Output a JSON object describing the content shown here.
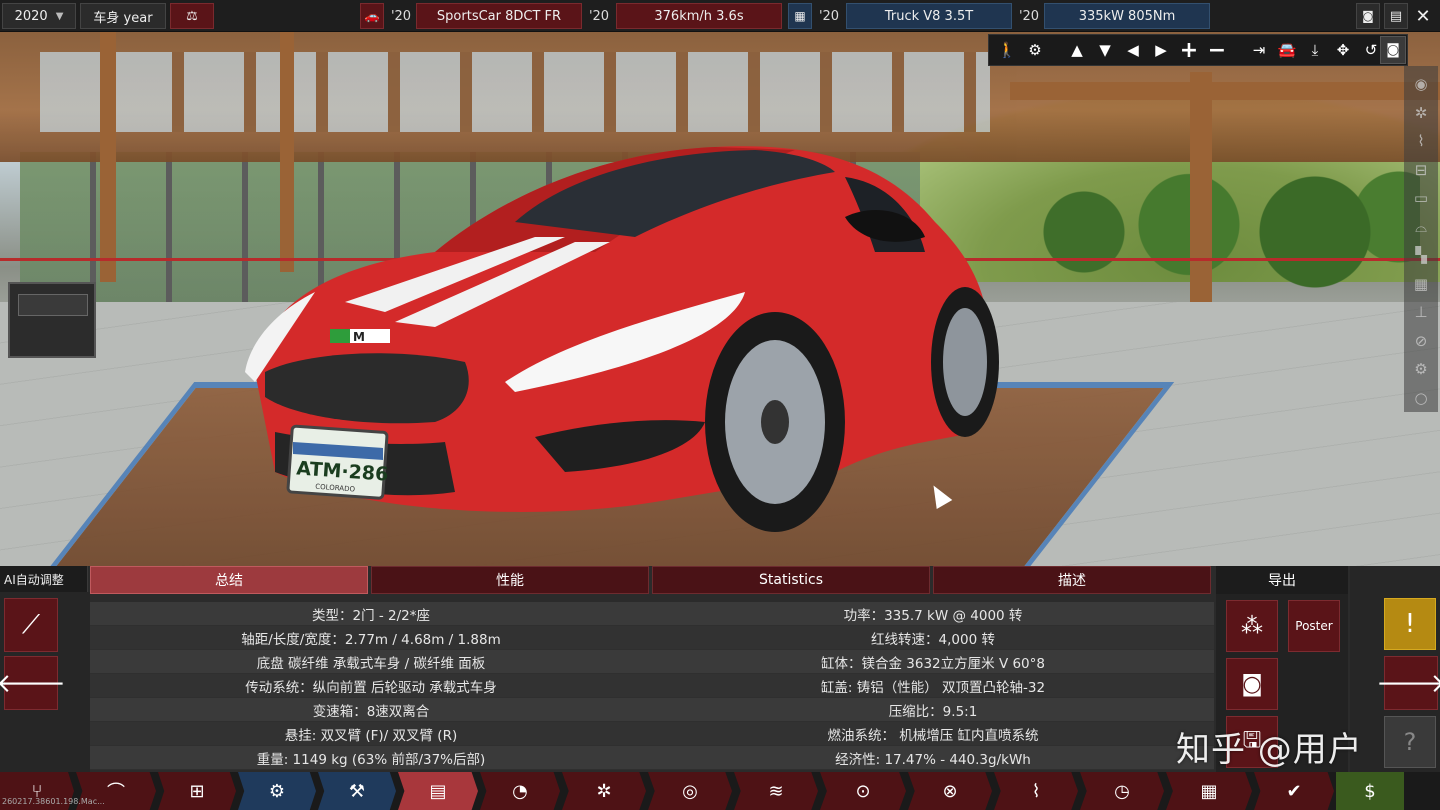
{
  "topbar": {
    "year": "2020",
    "body_year_label": "车身 year",
    "car_year": "'20",
    "car_name": "SportsCar 8DCT FR",
    "car_perf_year": "'20",
    "car_perf": "376km/h 3.6s",
    "truck_year": "'20",
    "truck_name": "Truck V8 3.5T",
    "truck_perf_year": "'20",
    "truck_perf": "335kW 805Nm"
  },
  "scene": {
    "plate_text": "ATM·286",
    "plate_state": "COLORADO",
    "badge": "M"
  },
  "panel": {
    "ai_label": "AI自动调整",
    "tabs": [
      "总结",
      "性能",
      "Statistics",
      "描述"
    ],
    "left_rows": [
      "类型：2门 - 2/2*座",
      "轴距/长度/宽度：2.77m / 4.68m / 1.88m",
      "底盘 碳纤维 承载式车身 / 碳纤维 面板",
      "传动系统：纵向前置 后轮驱动 承载式车身",
      "变速箱：8速双离合",
      "悬挂: 双叉臂 (F)/ 双叉臂 (R)",
      "重量: 1149 kg (63% 前部/37%后部)"
    ],
    "right_rows": [
      "功率：335.7 kW @ 4000 转",
      "红线转速：4,000 转",
      "缸体：镁合金 3632立方厘米 V 60°8",
      "缸盖: 铸铝（性能） 双顶置凸轮轴-32",
      "压缩比：9.5:1",
      "燃油系统： 机械增压 缸内直喷系统",
      "经济性: 17.47% - 440.3g/kWh"
    ],
    "export_label": "导出",
    "poster_label": "Poster"
  },
  "footer": {
    "version": "260217.38601.198.Mac...",
    "watermark": "知乎 @用户"
  },
  "icons": {
    "year_dropdown": "chevron-down-icon",
    "scale": "scale-icon",
    "camera": "camera-icon",
    "close": "close-icon"
  },
  "colors": {
    "accent_red": "#5a1418",
    "active_tab": "#9d3a3e",
    "blue_panel": "#1f3550",
    "warning": "#b58a12"
  }
}
